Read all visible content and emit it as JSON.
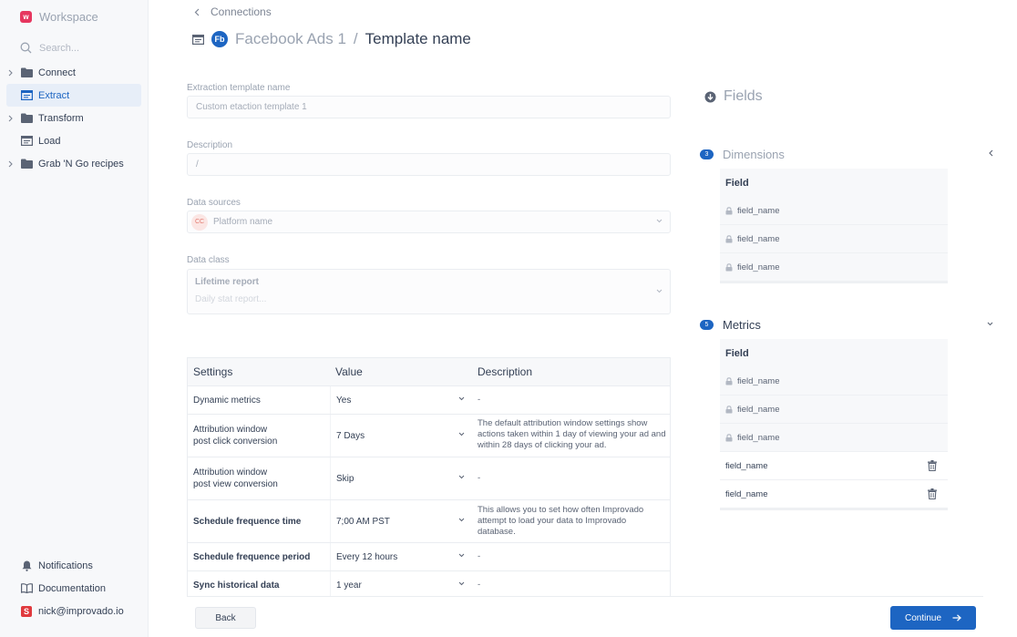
{
  "sidebar": {
    "brand_logo": "w",
    "brand_name": "Workspace",
    "search_placeholder": "Search...",
    "items": [
      {
        "label": "Connect",
        "icon": "folder-icon",
        "expandable": true
      },
      {
        "label": "Extract",
        "icon": "table-icon",
        "active": true
      },
      {
        "label": "Transform",
        "icon": "folder-icon",
        "expandable": true
      },
      {
        "label": "Load",
        "icon": "table-icon"
      },
      {
        "label": "Grab 'N Go recipes",
        "icon": "folder-icon",
        "expandable": true
      }
    ],
    "bottom": [
      {
        "label": "Notifications",
        "icon": "bell-icon"
      },
      {
        "label": "Documentation",
        "icon": "book-icon"
      },
      {
        "label": "nick@improvado.io",
        "icon": "avatar",
        "avatar_letter": "S"
      }
    ]
  },
  "header": {
    "back_label": "Connections",
    "connector_badge": "Fb",
    "connector_name": "Facebook Ads 1",
    "separator": "/",
    "page_title": "Template name"
  },
  "form": {
    "template_name": {
      "label": "Extraction template name",
      "value": "Custom etaction template 1"
    },
    "description": {
      "label": "Description",
      "value": "/"
    },
    "data_sources": {
      "label": "Data sources",
      "badge": "CC",
      "value": "Platform name"
    },
    "data_class": {
      "label": "Data class",
      "value": "Lifetime report",
      "placeholder": "Daily stat report..."
    }
  },
  "settings": {
    "headers": [
      "Settings",
      "Value",
      "Description"
    ],
    "rows": [
      {
        "name": "Dynamic metrics",
        "value": "Yes",
        "description": "-"
      },
      {
        "name": "Attribution window\npost click conversion",
        "value": "7 Days",
        "description": "The default attribution window settings show actions taken within 1 day of viewing your ad and within 28 days of clicking your ad."
      },
      {
        "name": "Attribution window\npost view conversion",
        "value": "Skip",
        "description": "-"
      },
      {
        "name": "Schedule frequence time",
        "value": "7;00 AM PST",
        "description": "This allows you to set how often Improvado attempt to load your data to Improvado database."
      },
      {
        "name": "Schedule frequence period",
        "value": "Every 12 hours",
        "description": "-"
      },
      {
        "name": "Sync historical data",
        "value": "1 year",
        "description": "-"
      }
    ]
  },
  "footer": {
    "back_label": "Back",
    "continue_label": "Continue"
  },
  "fields": {
    "title": "Fields",
    "dimensions": {
      "count": "3",
      "title": "Dimensions",
      "column": "Field",
      "rows": [
        "field_name",
        "field_name",
        "field_name"
      ]
    },
    "metrics": {
      "count": "5",
      "title": "Metrics",
      "column": "Field",
      "locked_rows": [
        "field_name",
        "field_name",
        "field_name"
      ],
      "removable_rows": [
        "field_name",
        "field_name"
      ]
    }
  },
  "colors": {
    "accent": "#1d65c2",
    "brand": "#e6365f",
    "text": "#344055",
    "muted": "#9aa3b1"
  }
}
